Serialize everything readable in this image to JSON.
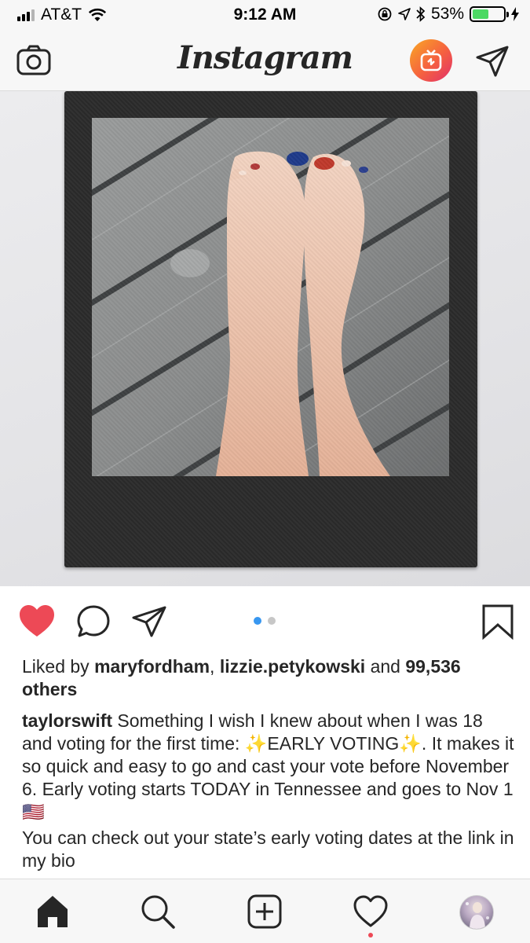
{
  "status_bar": {
    "carrier": "AT&T",
    "time": "9:12 AM",
    "battery_percent": "53%",
    "battery_level": 0.53,
    "signal_bars_filled": 3,
    "signal_bars_total": 4,
    "icons": [
      "wifi-icon",
      "rotation-lock-icon",
      "location-icon",
      "bluetooth-icon",
      "charging-icon"
    ]
  },
  "header": {
    "logo": "Instagram",
    "icons": [
      "camera-icon",
      "igtv-icon",
      "direct-message-icon"
    ],
    "igtv_gradient": [
      "#f9a825",
      "#f56040",
      "#e1306c"
    ]
  },
  "post": {
    "carousel": {
      "count": 2,
      "active": 1
    },
    "actions": [
      "heart-icon",
      "comment-icon",
      "share-icon",
      "bookmark-icon"
    ],
    "liked": true,
    "like_color": "#ed4956",
    "likes": {
      "prefix": "Liked by",
      "user1": "maryfordham",
      "separator": ",",
      "user2": "lizzie.petykowski",
      "and": "and",
      "others": "99,536 others"
    },
    "caption": {
      "username": "taylorswift",
      "text": "Something I wish I knew about when I was 18 and voting for the first time: ✨EARLY VOTING✨. It makes it so quick and easy to go and cast your vote before November 6. Early voting starts TODAY in Tennessee and goes to Nov 1 🇺🇸",
      "text2": "You can check out your state’s early voting dates at the link in my bio"
    }
  },
  "bottom_nav": {
    "items": [
      "home-icon",
      "search-icon",
      "new-post-icon",
      "activity-icon",
      "profile-avatar"
    ],
    "active": "home-icon"
  }
}
